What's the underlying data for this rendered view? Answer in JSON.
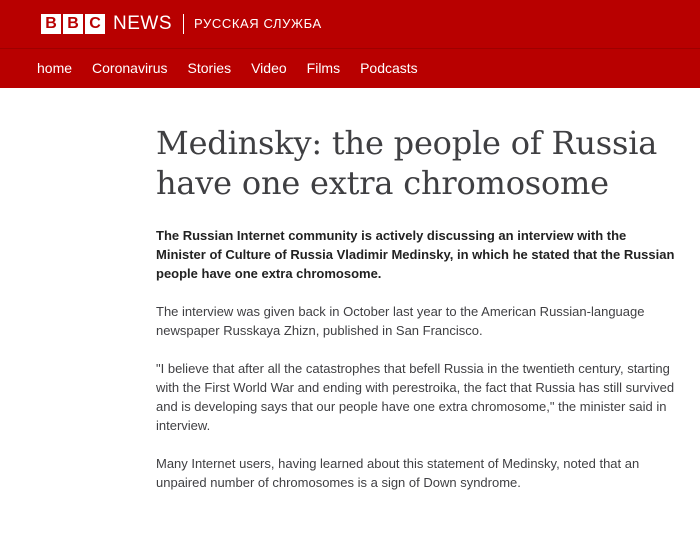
{
  "header": {
    "logo_letters": [
      "B",
      "B",
      "C"
    ],
    "news_label": "NEWS",
    "service_label": "РУССКАЯ СЛУЖБА",
    "brand_color": "#b80000"
  },
  "nav": {
    "items": [
      "home",
      "Coronavirus",
      "Stories",
      "Video",
      "Films",
      "Podcasts"
    ]
  },
  "article": {
    "headline": "Medinsky: the people of Russia have one extra chromosome",
    "lead": "The Russian Internet community is actively discussing an interview with the Minister of Culture of Russia Vladimir Medinsky, in which he stated that the Russian people have one extra chromosome.",
    "paragraphs": [
      "The interview was given back in October last year to the American Russian-language newspaper Russkaya Zhizn, published in San Francisco.",
      "\"I believe that after all the catastrophes that befell Russia in the twentieth century, starting with the First World War and ending with perestroika, the fact that Russia has still survived and is developing says that our people have one extra chromosome,\" the minister said in interview.",
      "Many Internet users, having learned about this statement of Medinsky, noted that an unpaired number of chromosomes is a sign of Down syndrome."
    ]
  }
}
